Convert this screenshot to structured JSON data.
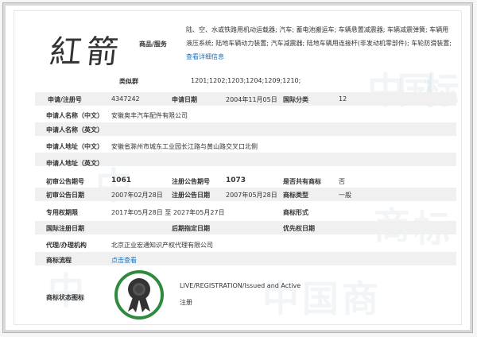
{
  "logo": {
    "text": "紅箭"
  },
  "watermarks": [
    "中",
    "国",
    "商",
    "标",
    "中",
    "国",
    "商",
    "标",
    "中",
    "国",
    "商",
    "标"
  ],
  "goods": {
    "label": "商品/服务",
    "text": "陆、空、水或铁路用机动运载器; 汽车; 蓄电池搬运车; 车辆悬置减震器; 车辆减震弹簧; 车辆用液压系统; 陆地车辆动力装置; 汽车减震器; 陆地车辆用连接杆(非发动机零部件); 车轮防滑装置;",
    "more_link": "查看详细信息"
  },
  "similar": {
    "label": "类似群",
    "value": "1201;1202;1203;1204;1209;1210;"
  },
  "application": {
    "reg_no_label": "申请/注册号",
    "reg_no": "4347242",
    "date_label": "申请日期",
    "date": "2004年11月05日",
    "class_label": "国际分类",
    "class": "12"
  },
  "applicant": {
    "name_cn_label": "申请人名称（中文）",
    "name_cn": "安徽奥丰汽车配件有限公司",
    "name_en_label": "申请人名称（英文）",
    "name_en": "",
    "addr_cn_label": "申请人地址（中文）",
    "addr_cn": "安徽省滁州市城东工业园长江路与黄山路交叉口北侧",
    "addr_en_label": "申请人地址（英文）",
    "addr_en": ""
  },
  "publication": {
    "first_no_label": "初审公告期号",
    "first_no": "1061",
    "reg_no_label": "注册公告期号",
    "reg_no": "1073",
    "shared_label": "是否共有商标",
    "shared": "否",
    "first_date_label": "初审公告日期",
    "first_date": "2007年02月28日",
    "reg_date_label": "注册公告日期",
    "reg_date": "2007年05月28日",
    "type_label": "商标类型",
    "type": "一般",
    "term_label": "专用权期限",
    "term_from": "2017年05月28日",
    "term_sep": "至",
    "term_to": "2027年05月27日",
    "form_label": "商标形式",
    "form": "",
    "intl_date_label": "国际注册日期",
    "intl_date": "",
    "later_date_label": "后期指定日期",
    "later_date": "",
    "priority_label": "优先权日期",
    "priority": ""
  },
  "agent": {
    "label": "代理/办理机构",
    "value": "北京正业宏通知识产权代理有限公司"
  },
  "process": {
    "label": "商标流程",
    "link": "点击查看"
  },
  "status": {
    "label": "商标状态图标",
    "line1": "LIVE/REGISTRATION/Issued and Active",
    "line2": "注册",
    "badge_color": "#2e8b3e"
  }
}
